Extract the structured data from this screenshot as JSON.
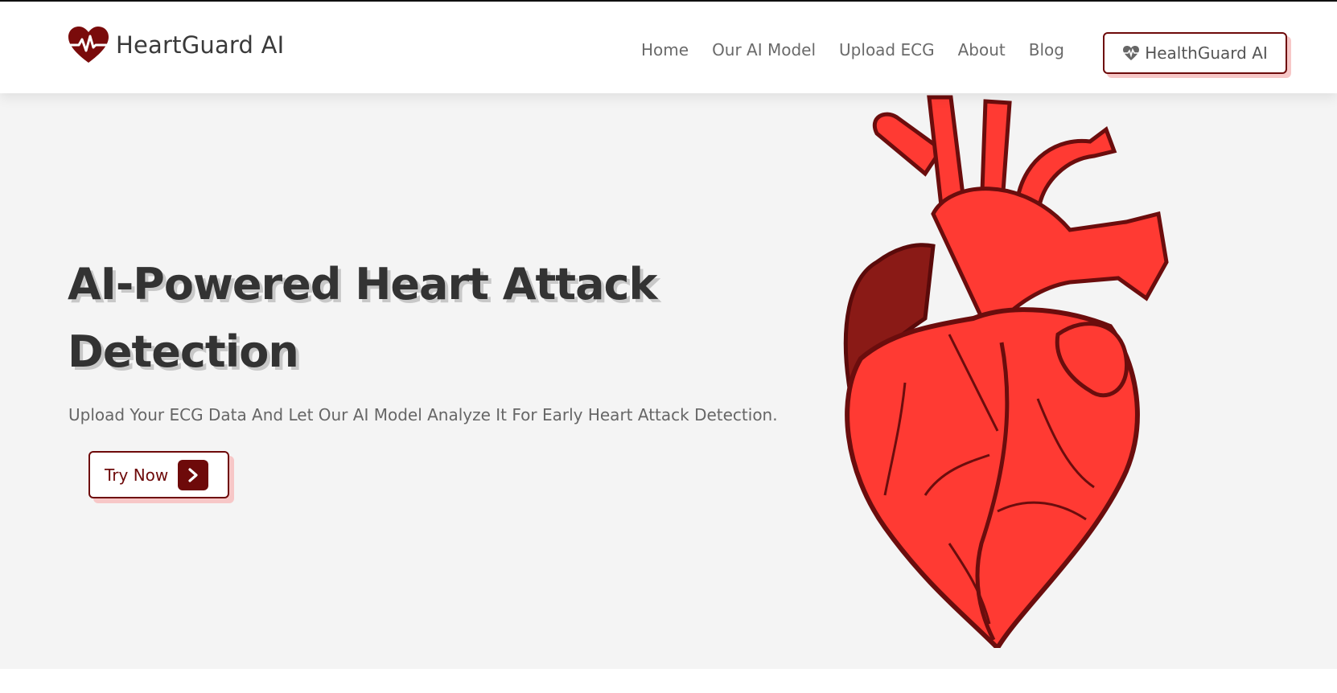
{
  "brand": {
    "name": "HeartGuard AI",
    "logo_icon": "heart-pulse-icon"
  },
  "nav": {
    "links": [
      "Home",
      "Our AI Model",
      "Upload ECG",
      "About",
      "Blog"
    ],
    "cta_label": "HealthGuard AI",
    "cta_icon": "heart-pulse-icon"
  },
  "hero": {
    "title_line1": "AI-Powered Heart Attack",
    "title_line2": "Detection",
    "subtitle": "Upload Your ECG Data And Let Our AI Model Analyze It For Early Heart Attack Detection.",
    "button_label": "Try Now",
    "button_icon": "chevron-right-icon",
    "image": "anatomical-heart-illustration"
  },
  "colors": {
    "accent": "#6e0a0a",
    "accent_shadow": "#f7c7c7",
    "heart_red": "#ff3a33",
    "heart_dark": "#6b0d0d",
    "hero_bg": "#f4f4f4"
  }
}
